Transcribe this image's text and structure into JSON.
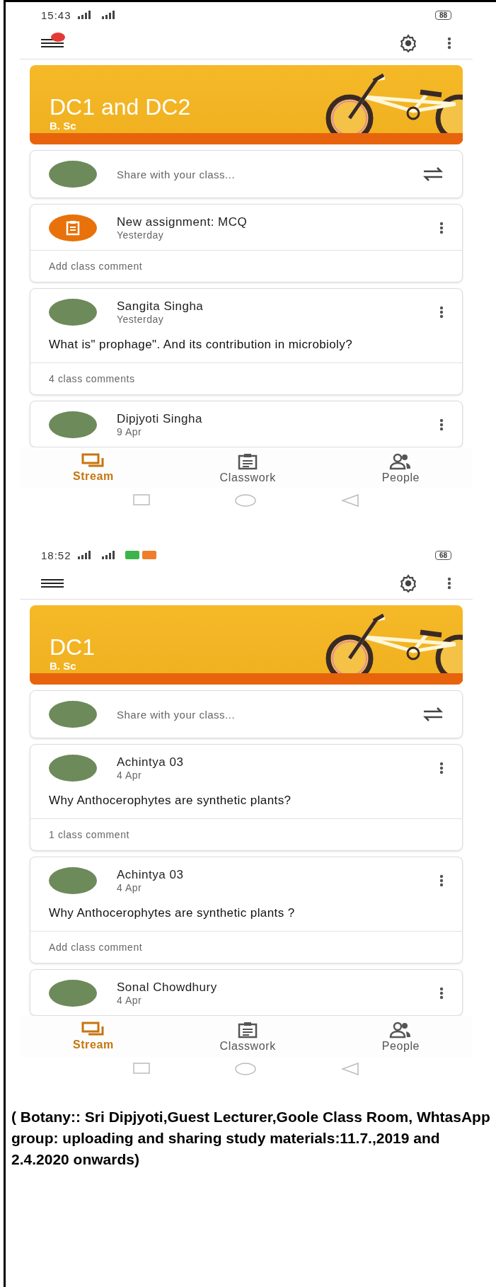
{
  "screens": [
    {
      "status_bar": {
        "time": "15:43",
        "battery": "88",
        "extra_icons": false
      },
      "toolbar": {
        "menu_notification": true
      },
      "class_banner": {
        "title": "DC1 and DC2",
        "subtitle": "B. Sc"
      },
      "share": {
        "placeholder": "Share with your class..."
      },
      "posts": [
        {
          "kind": "assignment",
          "title": "New assignment: MCQ",
          "date": "Yesterday",
          "footer": "Add class comment"
        },
        {
          "kind": "post",
          "title": "Sangita Singha",
          "date": "Yesterday",
          "body": "What is\" prophage\". And its contribution in microbioly?",
          "footer": "4 class comments"
        },
        {
          "kind": "post",
          "title": "Dipjyoti Singha",
          "date": "9 Apr"
        }
      ],
      "bottom_nav": [
        {
          "label": "Stream",
          "selected": true
        },
        {
          "label": "Classwork",
          "selected": false
        },
        {
          "label": "People",
          "selected": false
        }
      ]
    },
    {
      "status_bar": {
        "time": "18:52",
        "battery": "68",
        "extra_icons": true
      },
      "toolbar": {
        "menu_notification": false
      },
      "class_banner": {
        "title": "DC1",
        "subtitle": "B. Sc"
      },
      "share": {
        "placeholder": "Share with your class..."
      },
      "posts": [
        {
          "kind": "post",
          "title": "Achintya 03",
          "date": "4 Apr",
          "body": "Why Anthocerophytes are synthetic plants?",
          "footer": "1 class comment"
        },
        {
          "kind": "post",
          "title": "Achintya 03",
          "date": "4 Apr",
          "body": "Why Anthocerophytes are synthetic plants ?",
          "footer": "Add class comment"
        },
        {
          "kind": "post",
          "title": "Sonal Chowdhury",
          "date": "4 Apr"
        }
      ],
      "bottom_nav": [
        {
          "label": "Stream",
          "selected": true
        },
        {
          "label": "Classwork",
          "selected": false
        },
        {
          "label": "People",
          "selected": false
        }
      ]
    }
  ],
  "caption": "( Botany:: Sri Dipjyoti,Guest Lecturer,Goole Class Room, WhtasApp group: uploading and sharing study materials:11.7.,2019 and 2.4.2020 onwards)"
}
